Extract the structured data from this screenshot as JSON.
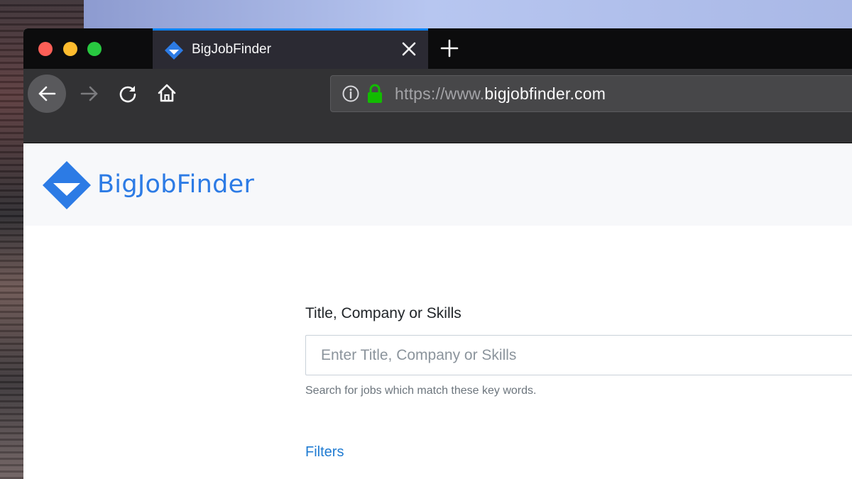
{
  "browser": {
    "tab": {
      "title": "BigJobFinder",
      "favicon": "bigjobfinder-logo-icon",
      "close_icon": "close-icon"
    },
    "new_tab_icon": "plus-icon",
    "nav": {
      "back_icon": "arrow-left-icon",
      "forward_icon": "arrow-right-icon",
      "reload_icon": "reload-icon",
      "home_icon": "home-icon"
    },
    "url": {
      "scheme_and_prefix": "https://www.",
      "domain": "bigjobfinder.com",
      "info_icon": "info-icon",
      "lock_icon": "lock-icon"
    },
    "window_controls": [
      "close",
      "minimize",
      "maximize"
    ]
  },
  "site": {
    "name": "BigJobFinder",
    "brand_color": "#2c7be5"
  },
  "search": {
    "label": "Title, Company or Skills",
    "placeholder": "Enter Title, Company or Skills",
    "value": "",
    "help": "Search for jobs which match these key words."
  },
  "filters": {
    "label": "Filters"
  },
  "colors": {
    "tab_accent": "#0a84ff",
    "lock_green": "#12bc00",
    "link_blue": "#1f7bd2"
  }
}
